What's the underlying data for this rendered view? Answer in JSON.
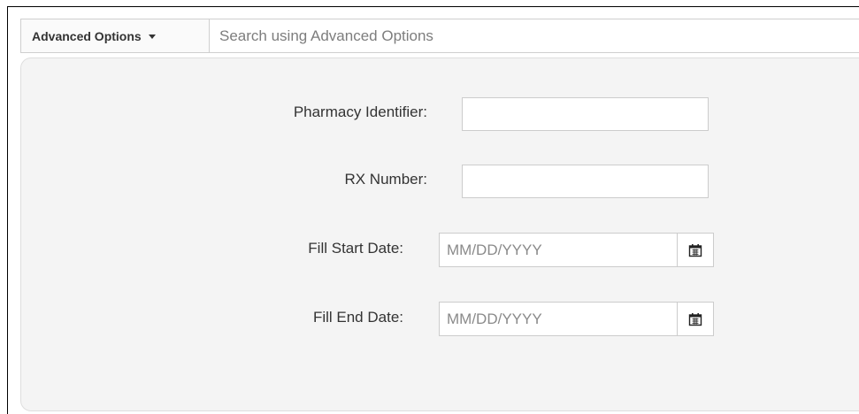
{
  "search": {
    "advanced_label": "Advanced Options",
    "placeholder": "Search using Advanced Options",
    "value": ""
  },
  "form": {
    "pharmacy_identifier": {
      "label": "Pharmacy Identifier:",
      "value": ""
    },
    "rx_number": {
      "label": "RX Number:",
      "value": ""
    },
    "fill_start_date": {
      "label": "Fill Start Date:",
      "placeholder": "MM/DD/YYYY",
      "value": "",
      "icon": "calendar-icon"
    },
    "fill_end_date": {
      "label": "Fill End Date:",
      "placeholder": "MM/DD/YYYY",
      "value": "",
      "icon": "calendar-icon"
    }
  },
  "colors": {
    "panel_bg": "#f4f4f4",
    "border": "#cccccc",
    "text": "#333333",
    "placeholder": "#8a8a8a"
  }
}
